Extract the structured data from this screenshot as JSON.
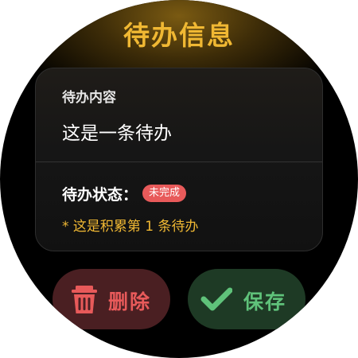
{
  "header": {
    "title": "待办信息"
  },
  "todo": {
    "content_label": "待办内容",
    "content_value": "这是一条待办",
    "status_label": "待办状态：",
    "status_badge": "未完成",
    "note": "* 这是积累第 1 条待办"
  },
  "actions": {
    "delete_label": "删除",
    "save_label": "保存"
  },
  "colors": {
    "accent": "#f0b833",
    "danger": "#e85a5a",
    "success": "#5fc27a",
    "background": "#000000"
  },
  "icons": {
    "delete": "trash-icon",
    "save": "checkmark-icon"
  }
}
